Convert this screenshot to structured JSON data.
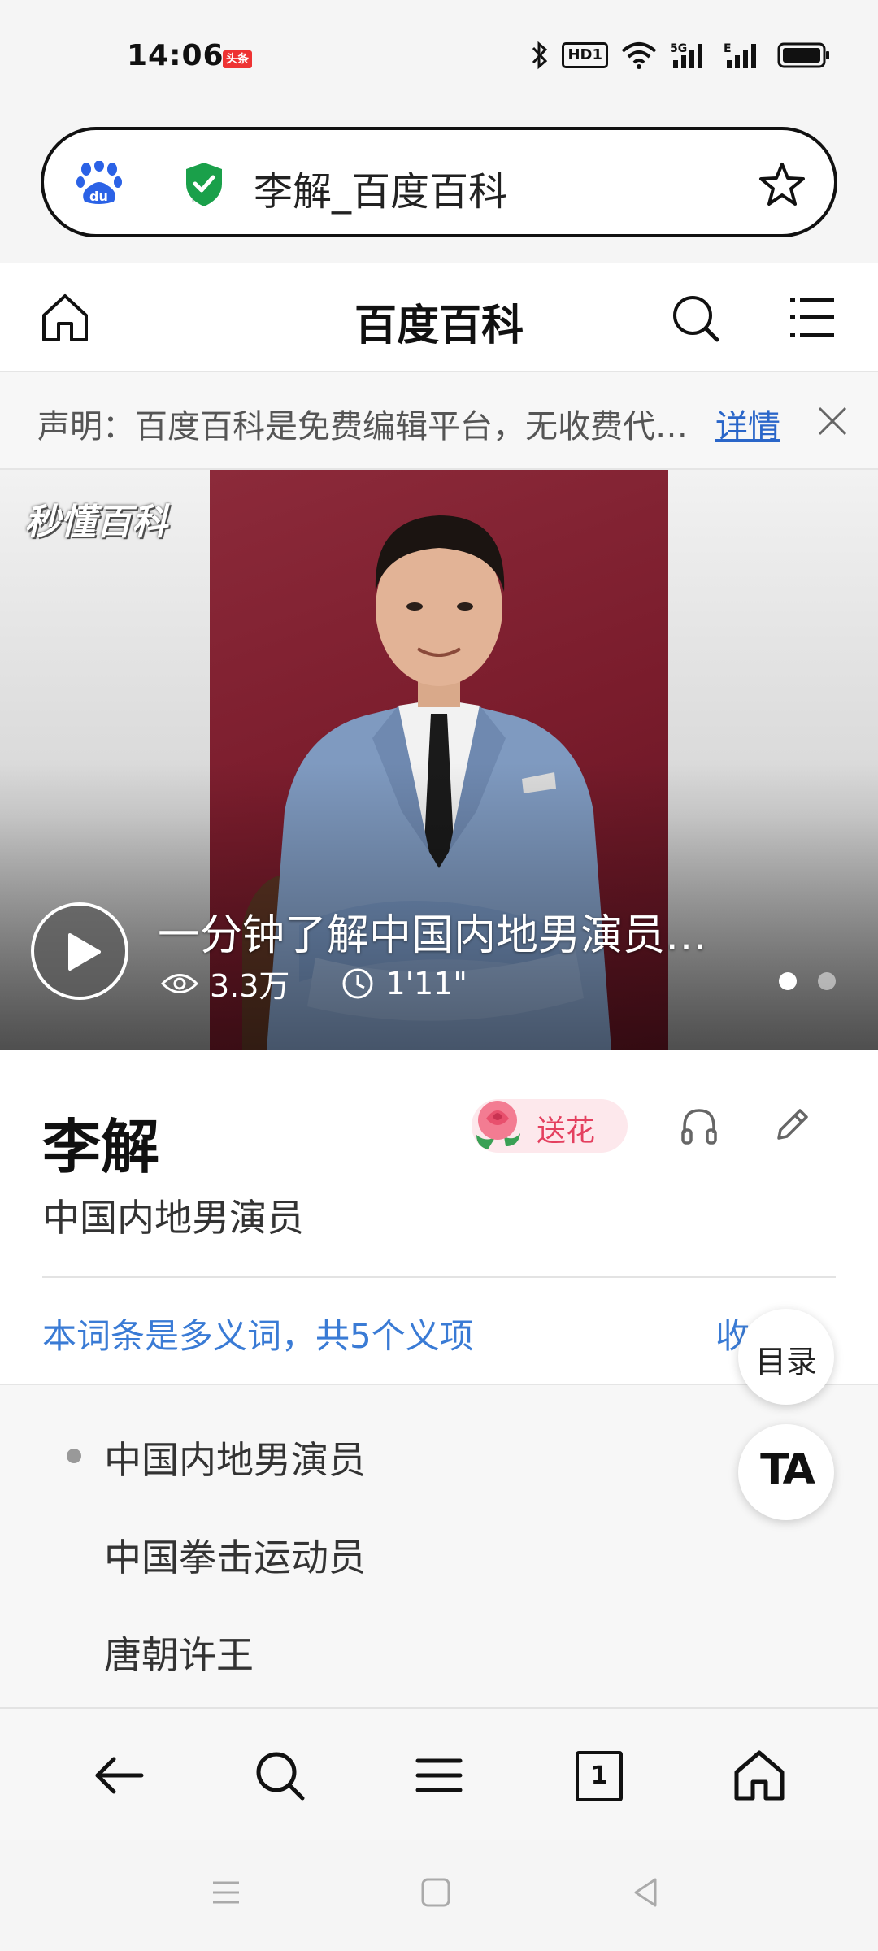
{
  "status_bar": {
    "time": "14:06",
    "badge": "头条",
    "icons": [
      "bluetooth-icon",
      "hd-icon",
      "wifi-icon",
      "5g-signal-icon",
      "e-signal-icon",
      "battery-icon"
    ],
    "hd_label": "HD1"
  },
  "address_bar": {
    "page_title": "李解_百度百科",
    "icons": [
      "baidu-paw-icon",
      "security-shield-icon",
      "star-icon"
    ]
  },
  "header": {
    "title": "百度百科",
    "icons": [
      "home-icon",
      "search-icon",
      "menu-icon"
    ]
  },
  "notice": {
    "text": "声明：百度百科是免费编辑平台，无收费代…",
    "link_label": "详情",
    "close_icon": "close-icon"
  },
  "video": {
    "brand": "秒懂百科",
    "title": "一分钟了解中国内地男演员…",
    "views": "3.3万",
    "duration": "1'11\"",
    "slide_count": 2,
    "active_slide": 1
  },
  "entry": {
    "title": "李解",
    "flower_label": "送花",
    "subtitle": "中国内地男演员",
    "polysemy_note": "本词条是多义词，共5个义项",
    "collapse_label": "收起"
  },
  "senses": [
    {
      "label": "中国内地男演员",
      "active": true
    },
    {
      "label": "中国拳击运动员",
      "active": false
    },
    {
      "label": "唐朝许王",
      "active": false
    }
  ],
  "floating": {
    "toc_label": "目录",
    "ta_label": "TA"
  },
  "bottom_nav": {
    "tab_count": "1",
    "icons": [
      "back-arrow-icon",
      "search-icon",
      "menu-icon",
      "tabs-icon",
      "home-icon"
    ]
  },
  "colors": {
    "link_blue": "#3a7bd5",
    "shield_green": "#1aa04a",
    "baidu_blue": "#2b62e6",
    "flower_pink": "#e4405f"
  }
}
